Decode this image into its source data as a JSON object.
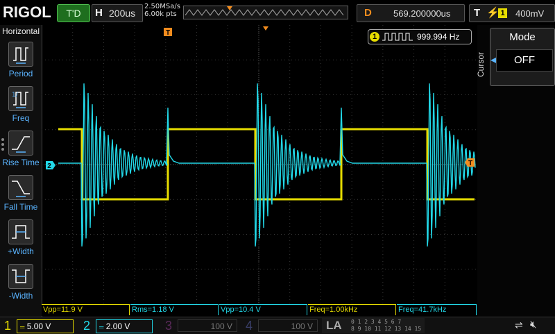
{
  "top": {
    "brand": "RIGOL",
    "run_state": "T'D",
    "horizontal_label": "H",
    "timebase": "200us",
    "sample_rate": "2.50MSa/s",
    "mem_depth": "6.00k pts",
    "delay_label": "D",
    "delay_value": "569.200000us",
    "trigger_label": "T",
    "trigger_channel": "1",
    "trigger_level": "400mV"
  },
  "left_menu": {
    "title": "Horizontal",
    "items": [
      {
        "label": "Period",
        "icon": "period-icon"
      },
      {
        "label": "Freq",
        "icon": "freq-icon"
      },
      {
        "label": "Rise Time",
        "icon": "rise-time-icon"
      },
      {
        "label": "Fall Time",
        "icon": "fall-time-icon"
      },
      {
        "label": "+Width",
        "icon": "positive-width-icon"
      },
      {
        "label": "-Width",
        "icon": "negative-width-icon"
      }
    ]
  },
  "right_menu": {
    "side_label": "Cursor",
    "mode_title": "Mode",
    "mode_value": "OFF"
  },
  "freq_counter": {
    "channel": "1",
    "value": "999.994 Hz"
  },
  "markers": {
    "ch2_marker": "2",
    "trig_level_marker": "T",
    "trig_pos_marker": "T"
  },
  "measurements": [
    {
      "text": "Vpp=11.9 V",
      "color": "#e6dc00"
    },
    {
      "text": "Rms=1.18 V",
      "color": "#22d8e8"
    },
    {
      "text": "Vpp=10.4 V",
      "color": "#22d8e8"
    },
    {
      "text": "Freq=1.00kHz",
      "color": "#e6dc00"
    },
    {
      "text": "Freq=41.7kHz",
      "color": "#22d8e8"
    }
  ],
  "channels": [
    {
      "num": "1",
      "scale": "5.00 V",
      "color": "#e6dc00",
      "active": true
    },
    {
      "num": "2",
      "scale": "2.00 V",
      "color": "#22d8e8",
      "active": true
    },
    {
      "num": "3",
      "scale": "100 V",
      "color": "#c23bc2",
      "active": false
    },
    {
      "num": "4",
      "scale": "100 V",
      "color": "#3b6cff",
      "active": false
    }
  ],
  "la": {
    "label": "LA",
    "row1": "0 1 2 3  4 5 6 7",
    "row2": "8 9 10 11  12 13 14 15"
  },
  "colors": {
    "ch1": "#e6dc00",
    "ch2": "#22d8e8",
    "trigger": "#f28c1e",
    "accent": "#5ab4ff"
  },
  "signals": {
    "period_us": 1000,
    "timebase_us_per_div": 200,
    "ch2_ring_freq_khz": 41.7
  }
}
